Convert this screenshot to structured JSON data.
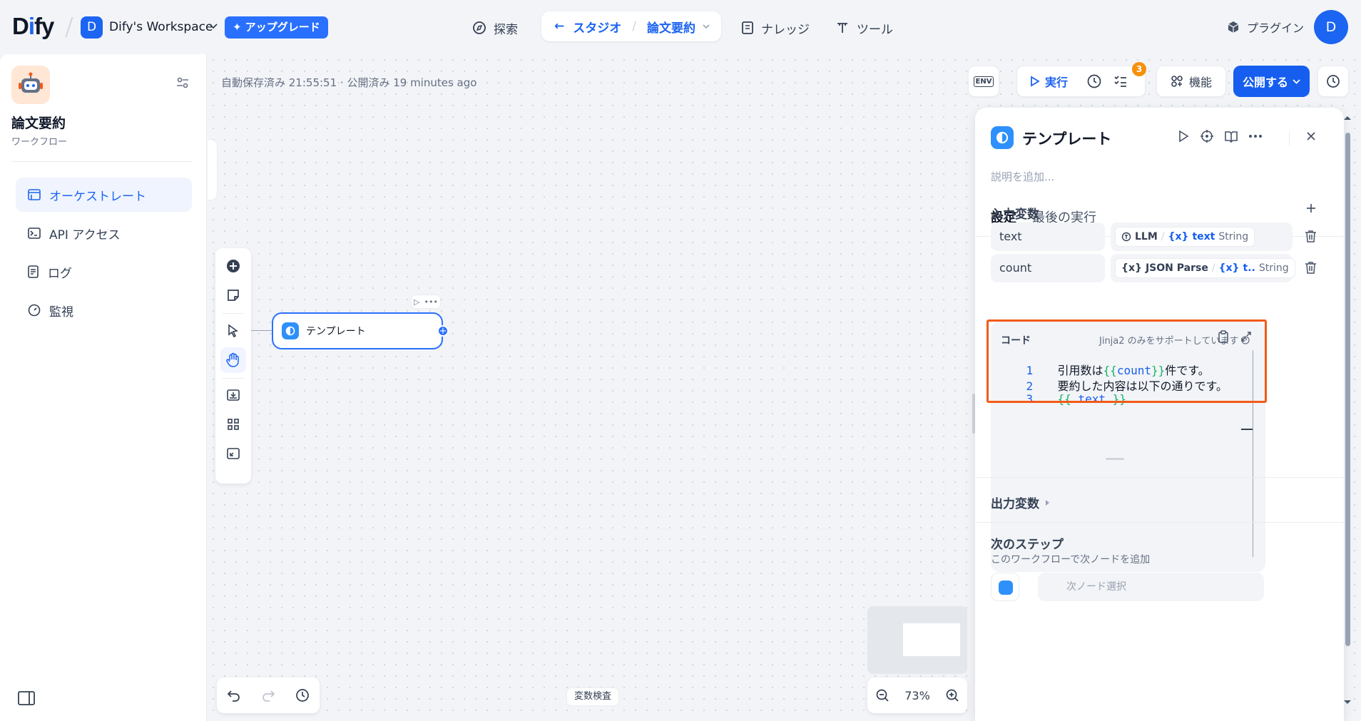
{
  "brand": {
    "logo_prefix": "D",
    "logo_i": "i",
    "logo_suffix": "fy"
  },
  "workspace": {
    "avatar": "D",
    "name": "Dify's Workspace",
    "upgrade": "アップグレード"
  },
  "nav": {
    "explore": "探索",
    "studio": "スタジオ",
    "app": "論文要約",
    "knowledge": "ナレッジ",
    "tools": "ツール",
    "plugins": "プラグイン",
    "user_avatar": "D"
  },
  "sidebar": {
    "app_name": "論文要約",
    "app_type": "ワークフロー",
    "items": [
      {
        "label": "オーケストレート",
        "active": true
      },
      {
        "label": "API アクセス"
      },
      {
        "label": "ログ"
      },
      {
        "label": "監視"
      }
    ]
  },
  "canvas": {
    "autosave": "自動保存済み 21:55:51 · 公開済み 19 minutes ago",
    "node_label": "テンプレート",
    "node_handle": "+",
    "var_inspect": "変数検査",
    "zoom": "73%"
  },
  "toolbar": {
    "env": "ENV",
    "run": "実行",
    "badge": "3",
    "features": "機能",
    "publish": "公開する"
  },
  "panel": {
    "title": "テンプレート",
    "desc_placeholder": "説明を追加...",
    "tabs": [
      "設定",
      "最後の実行"
    ],
    "input_vars_title": "入力変数",
    "vars": [
      {
        "name": "text",
        "node": "LLM",
        "var": "text",
        "type": "String"
      },
      {
        "name": "count",
        "node": "JSON Parse",
        "var": "t..",
        "type": "String"
      }
    ],
    "code": {
      "label": "コード",
      "hint": "Jinja2 のみをサポートしています",
      "lines": [
        {
          "n": "1",
          "pre": "引用数は",
          "open": "{{",
          "var": "count",
          "close": "}}",
          "post": "件です。"
        },
        {
          "n": "2",
          "text": "要約した内容は以下の通りです。"
        },
        {
          "n": "3",
          "open": "{{",
          "var": " text ",
          "close": "}}"
        }
      ]
    },
    "output_vars_title": "出力変数",
    "next_step_title": "次のステップ",
    "next_step_sub": "このワークフローで次ノードを追加",
    "next_select": "次ノード選択"
  },
  "colors": {
    "accent": "#155eef",
    "highlight": "#f35a17",
    "badge": "#f79009"
  }
}
